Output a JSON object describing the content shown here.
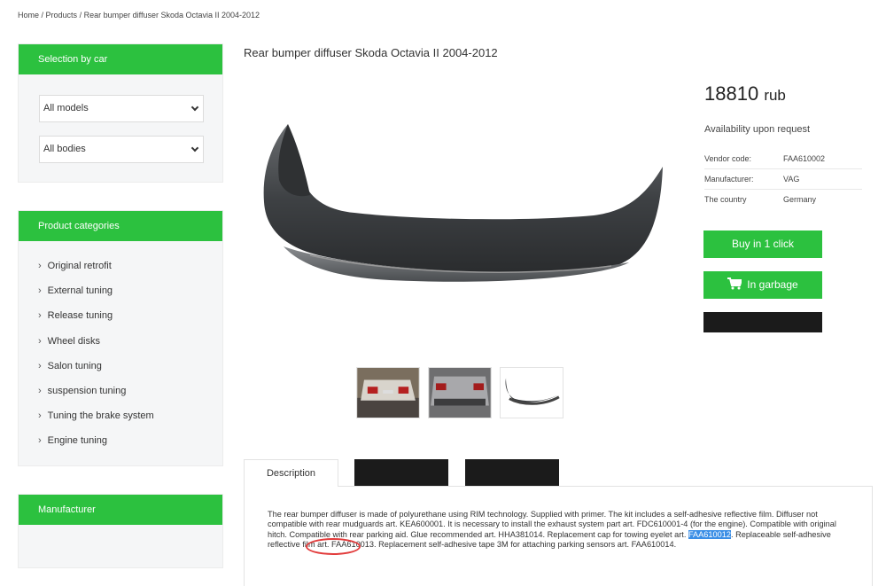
{
  "breadcrumb": {
    "home": "Home",
    "sep": " / ",
    "products": "Products",
    "current": "Rear bumper diffuser Skoda Octavia II 2004-2012"
  },
  "sidebar": {
    "selection_title": "Selection by car",
    "model_select": "All models",
    "body_select": "All bodies",
    "categories_title": "Product categories",
    "categories": [
      "Original retrofit",
      "External tuning",
      "Release tuning",
      "Wheel disks",
      "Salon tuning",
      "suspension tuning",
      "Tuning the brake system",
      "Engine tuning"
    ],
    "manufacturer_title": "Manufacturer"
  },
  "product": {
    "title": "Rear bumper diffuser Skoda Octavia II 2004-2012",
    "price": "18810",
    "currency": "rub",
    "availability": "Availability upon request",
    "specs": [
      {
        "key": "Vendor code:",
        "value": "FAA610002"
      },
      {
        "key": "Manufacturer:",
        "value": "VAG"
      },
      {
        "key": "The country",
        "value": "Germany"
      }
    ],
    "buy_one_click": "Buy in 1 click",
    "in_garbage": "In garbage"
  },
  "tabs": {
    "description": "Description"
  },
  "description": {
    "part1": "The rear bumper diffuser is made of polyurethane using RIM technology. Supplied with primer. The kit includes a self-adhesive reflective film. Diffuser not compatible with rear mudguards art. KEA600001. It is necessary to install the exhaust system part art. FDC610001-4 (for the engine). Compatible with original hitch. Compatible with rear parking aid. Glue recommended art. HHA381014. Replacement cap for towing eyelet art. ",
    "highlight": "FAA610012",
    "part2": ". Replaceable self-adhesive reflective film art. FAA610013. Replacement self-adhesive tape 3M for attaching parking sensors art. FAA610014."
  },
  "colors": {
    "accent": "#2cc13f",
    "dark": "#1b1b1b",
    "highlight": "#3a8ee6",
    "circle": "#e23b3b"
  }
}
